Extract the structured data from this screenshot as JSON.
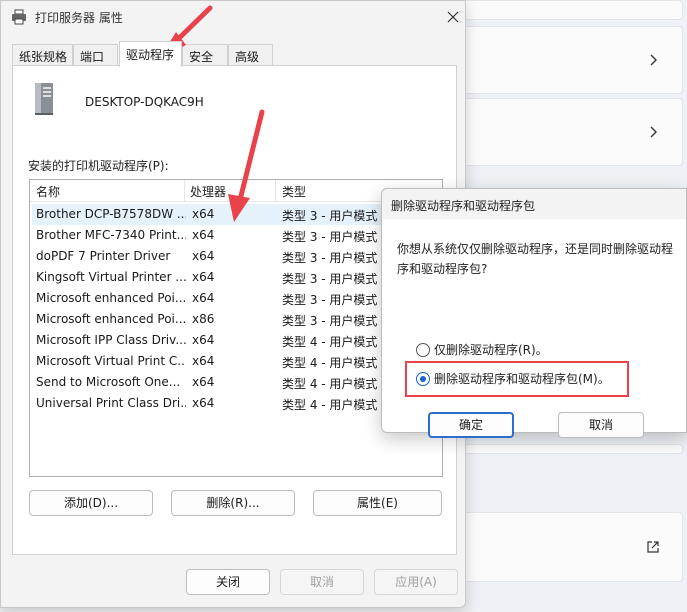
{
  "dialog": {
    "title": "打印服务器 属性",
    "tabs": [
      "纸张规格",
      "端口",
      "驱动程序",
      "安全",
      "高级"
    ],
    "active_tab": "驱动程序",
    "server_name": "DESKTOP-DQKAC9H",
    "list_caption": "安装的打印机驱动程序(P):",
    "columns": [
      "名称",
      "处理器",
      "类型"
    ],
    "drivers": [
      {
        "name": "Brother DCP-B7578DW ...",
        "processor": "x64",
        "type": "类型 3 - 用户模式"
      },
      {
        "name": "Brother MFC-7340 Print...",
        "processor": "x64",
        "type": "类型 3 - 用户模式"
      },
      {
        "name": "doPDF 7 Printer Driver",
        "processor": "x64",
        "type": "类型 3 - 用户模式"
      },
      {
        "name": "Kingsoft Virtual Printer ...",
        "processor": "x64",
        "type": "类型 3 - 用户模式"
      },
      {
        "name": "Microsoft enhanced Poi...",
        "processor": "x64",
        "type": "类型 3 - 用户模式"
      },
      {
        "name": "Microsoft enhanced Poi...",
        "processor": "x86",
        "type": "类型 3 - 用户模式"
      },
      {
        "name": "Microsoft IPP Class Driv...",
        "processor": "x64",
        "type": "类型 4 - 用户模式"
      },
      {
        "name": "Microsoft Virtual Print C...",
        "processor": "x64",
        "type": "类型 4 - 用户模式"
      },
      {
        "name": "Send to Microsoft One...",
        "processor": "x64",
        "type": "类型 4 - 用户模式"
      },
      {
        "name": "Universal Print Class Dri...",
        "processor": "x64",
        "type": "类型 4 - 用户模式"
      }
    ],
    "add_button": "添加(D)...",
    "remove_button": "删除(R)...",
    "properties_button": "属性(E)",
    "close_button": "关闭",
    "cancel_button": "取消",
    "apply_button": "应用(A)"
  },
  "confirm": {
    "title": "删除驱动程序和驱动程序包",
    "question": "你想从系统仅仅删除驱动程序，还是同时删除驱动程序和驱动程序包?",
    "option_driver_only": "仅删除驱动程序(R)。",
    "option_driver_and_package": "删除驱动程序和驱动程序包(M)。",
    "selected_option": "删除驱动程序和驱动程序包(M)。",
    "ok_button": "确定",
    "cancel_button": "取消"
  },
  "colors": {
    "annotation_red": "#e8434b",
    "radio_blue": "#1a64c8"
  },
  "icons": {
    "title": "printer-icon",
    "server": "server-tower-icon",
    "close": "close-icon",
    "chevron": "chevron-right-icon",
    "external": "external-link-icon"
  }
}
